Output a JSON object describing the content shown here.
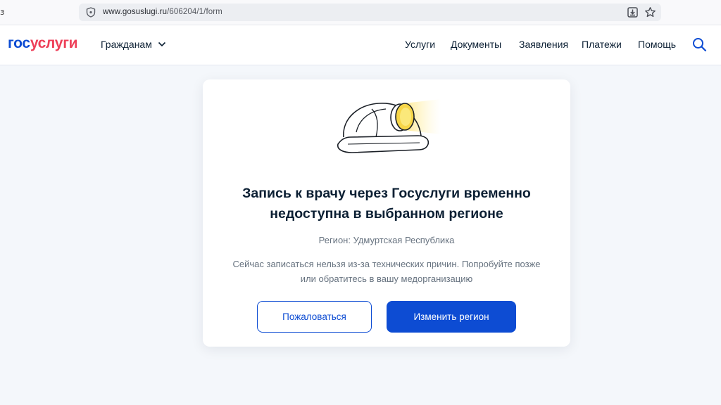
{
  "browser": {
    "left_glyph": "з",
    "url_host": "www.gosuslugi.ru",
    "url_path": "/606204/1/form"
  },
  "header": {
    "logo_part1": "гос",
    "logo_part2": "услуги",
    "citizens_menu": "Гражданам",
    "nav": [
      "Услуги",
      "Документы",
      "Заявления",
      "Платежи",
      "Помощь"
    ]
  },
  "card": {
    "title_line1": "Запись к врачу через Госуслуги временно",
    "title_line2": "недоступна в выбранном регионе",
    "region": "Регион: Удмуртская Республика",
    "desc_line1": "Сейчас записаться нельзя из-за технических причин. Попробуйте позже",
    "desc_line2": "или обратитесь в вашу медорганизацию",
    "complain_button": "Пожаловаться",
    "change_region_button": "Изменить регион"
  },
  "colors": {
    "brand_blue": "#0d4cd3",
    "brand_red": "#ee3f58",
    "text_dark": "#0b1f33",
    "text_muted": "#66727f",
    "background": "#f4f7fb"
  },
  "icons": [
    "shield-icon",
    "download-icon",
    "star-icon",
    "chevron-down-icon",
    "search-icon",
    "helmet-icon"
  ]
}
